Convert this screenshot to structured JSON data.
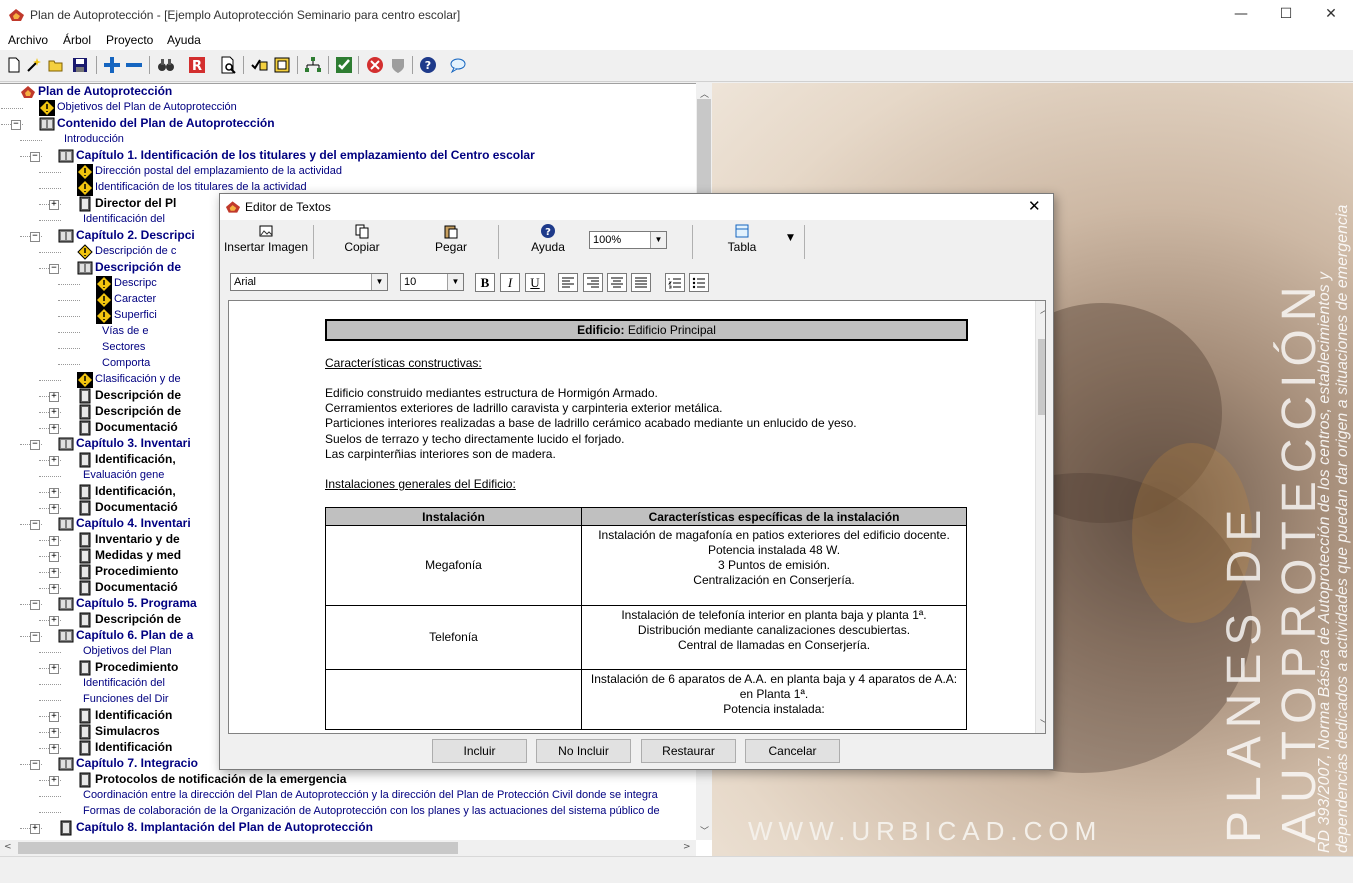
{
  "window": {
    "title": "Plan de Autoprotección - [Ejemplo Autoprotección Seminario para centro escolar]",
    "min": "—",
    "max": "☐",
    "close": "✕"
  },
  "menu": [
    "Archivo",
    "Árbol",
    "Proyecto",
    "Ayuda"
  ],
  "toolbar_icons": [
    "new-icon",
    "wand-icon",
    "open-icon",
    "save-icon",
    "add-icon",
    "remove-icon",
    "binoculars-icon",
    "report-icon",
    "preview-icon",
    "check-list-icon",
    "note-icon",
    "tree-icon",
    "check-icon",
    "stop-icon",
    "shield-icon",
    "help-icon",
    "chat-icon"
  ],
  "tree": [
    {
      "level": 0,
      "label": "Plan de Autoprotección",
      "style": "b",
      "icon": "root",
      "exp": ""
    },
    {
      "level": 1,
      "label": "Objetivos del Plan de Autoprotección",
      "style": "n",
      "icon": "warn",
      "exp": ""
    },
    {
      "level": 1,
      "label": "Contenido del Plan de Autoprotección",
      "style": "b",
      "icon": "book",
      "exp": "-"
    },
    {
      "level": 2,
      "label": "Introducción",
      "style": "n",
      "icon": "",
      "exp": ""
    },
    {
      "level": 2,
      "label": "Capítulo 1. Identificación de los titulares y del emplazamiento del Centro escolar",
      "style": "b",
      "icon": "book",
      "exp": "-"
    },
    {
      "level": 3,
      "label": "Dirección postal del emplazamiento de la actividad",
      "style": "n",
      "icon": "warn",
      "exp": ""
    },
    {
      "level": 3,
      "label": "Identificación de los titulares de la actividad",
      "style": "n",
      "icon": "warn",
      "exp": ""
    },
    {
      "level": 3,
      "label": "Director del Pl",
      "style": "bk",
      "icon": "doc",
      "exp": "+"
    },
    {
      "level": 3,
      "label": "Identificación del",
      "style": "n",
      "icon": "",
      "exp": ""
    },
    {
      "level": 2,
      "label": "Capítulo 2. Descripci",
      "style": "b",
      "icon": "book",
      "exp": "-"
    },
    {
      "level": 3,
      "label": "Descripción de c",
      "style": "n",
      "icon": "warn2",
      "exp": ""
    },
    {
      "level": 3,
      "label": "Descripción de",
      "style": "b",
      "icon": "book",
      "exp": "-"
    },
    {
      "level": 4,
      "label": "Descripc",
      "style": "n",
      "icon": "warn",
      "exp": ""
    },
    {
      "level": 4,
      "label": "Caracter",
      "style": "n",
      "icon": "warn",
      "exp": ""
    },
    {
      "level": 4,
      "label": "Superfici",
      "style": "n",
      "icon": "warn",
      "exp": ""
    },
    {
      "level": 4,
      "label": "Vías de e",
      "style": "n",
      "icon": "",
      "exp": ""
    },
    {
      "level": 4,
      "label": "Sectores",
      "style": "n",
      "icon": "",
      "exp": ""
    },
    {
      "level": 4,
      "label": "Comporta",
      "style": "n",
      "icon": "",
      "exp": ""
    },
    {
      "level": 3,
      "label": "Clasificación y de",
      "style": "n",
      "icon": "warn",
      "exp": ""
    },
    {
      "level": 3,
      "label": "Descripción de",
      "style": "bk",
      "icon": "doc",
      "exp": "+"
    },
    {
      "level": 3,
      "label": "Descripción de",
      "style": "bk",
      "icon": "doc",
      "exp": "+"
    },
    {
      "level": 3,
      "label": "Documentació",
      "style": "bk",
      "icon": "doc",
      "exp": "+"
    },
    {
      "level": 2,
      "label": "Capítulo 3. Inventari",
      "style": "b",
      "icon": "book",
      "exp": "-"
    },
    {
      "level": 3,
      "label": "Identificación,",
      "style": "bk",
      "icon": "doc",
      "exp": "+"
    },
    {
      "level": 3,
      "label": "Evaluación gene",
      "style": "n",
      "icon": "",
      "exp": ""
    },
    {
      "level": 3,
      "label": "Identificación,",
      "style": "bk",
      "icon": "doc",
      "exp": "+"
    },
    {
      "level": 3,
      "label": "Documentació",
      "style": "bk",
      "icon": "doc",
      "exp": "+"
    },
    {
      "level": 2,
      "label": "Capítulo 4. Inventari",
      "style": "b",
      "icon": "book",
      "exp": "-"
    },
    {
      "level": 3,
      "label": "Inventario y de",
      "style": "bk",
      "icon": "doc",
      "exp": "+"
    },
    {
      "level": 3,
      "label": "Medidas y med",
      "style": "bk",
      "icon": "doc",
      "exp": "+"
    },
    {
      "level": 3,
      "label": "Procedimiento",
      "style": "bk",
      "icon": "doc",
      "exp": "+"
    },
    {
      "level": 3,
      "label": "Documentació",
      "style": "bk",
      "icon": "doc",
      "exp": "+"
    },
    {
      "level": 2,
      "label": "Capítulo 5. Programa",
      "style": "b",
      "icon": "book",
      "exp": "-"
    },
    {
      "level": 3,
      "label": "Descripción de",
      "style": "bk",
      "icon": "doc",
      "exp": "+"
    },
    {
      "level": 2,
      "label": "Capítulo 6. Plan de a",
      "style": "b",
      "icon": "book",
      "exp": "-"
    },
    {
      "level": 3,
      "label": "Objetivos del Plan",
      "style": "n",
      "icon": "",
      "exp": ""
    },
    {
      "level": 3,
      "label": "Procedimiento",
      "style": "bk",
      "icon": "doc",
      "exp": "+"
    },
    {
      "level": 3,
      "label": "Identificación del",
      "style": "n",
      "icon": "",
      "exp": ""
    },
    {
      "level": 3,
      "label": "Funciones del Dir",
      "style": "n",
      "icon": "",
      "exp": ""
    },
    {
      "level": 3,
      "label": "Identificación",
      "style": "bk",
      "icon": "doc",
      "exp": "+"
    },
    {
      "level": 3,
      "label": "Simulacros",
      "style": "bk",
      "icon": "doc",
      "exp": "+"
    },
    {
      "level": 3,
      "label": "Identificación",
      "style": "bk",
      "icon": "doc",
      "exp": "+"
    },
    {
      "level": 2,
      "label": "Capítulo 7. Integracio",
      "style": "b",
      "icon": "book",
      "exp": "-"
    },
    {
      "level": 3,
      "label": "Protocolos de notificación de la emergencia",
      "style": "bk",
      "icon": "doc",
      "exp": "+"
    },
    {
      "level": 3,
      "label": "Coordinación entre la dirección del Plan de Autoprotección y la dirección del Plan de Protección Civil donde se integra",
      "style": "n",
      "icon": "",
      "exp": ""
    },
    {
      "level": 3,
      "label": "Formas de colaboración de la Organización de Autoprotección con los planes y las actuaciones del sistema público de",
      "style": "n",
      "icon": "",
      "exp": ""
    },
    {
      "level": 2,
      "label": "Capítulo 8. Implantación del Plan de Autoprotección",
      "style": "b",
      "icon": "doc",
      "exp": "+"
    }
  ],
  "splash": {
    "big1": "PLANES DE",
    "big2": "AUTOPROTECCIÓN",
    "small1": "RD 393/2007, Norma Básica de Autoprotección de los centros, establecimientos y",
    "small2": "dependencias dedicados a actividades que puedan dar origen a situaciones de emergencia",
    "url": "WWW.URBICAD.COM"
  },
  "dialog": {
    "title": "Editor de Textos",
    "close": "✕",
    "tools": {
      "insert_image": "Insertar Imagen",
      "copy": "Copiar",
      "paste": "Pegar",
      "help": "Ayuda",
      "zoom": "100%",
      "table": "Tabla"
    },
    "font": "Arial",
    "size": "10",
    "fmt": {
      "bold": "B",
      "italic": "I",
      "underline": "U"
    },
    "document": {
      "heading_bold": "Edificio:",
      "heading_rest": " Edificio Principal",
      "section1": "Características constructivas:",
      "lines": [
        " Edificio construido mediantes estructura de Hormigón Armado.",
        "Cerramientos exteriores de ladrillo caravista y carpinteria exterior metálica.",
        "Particiones interiores realizadas a base de ladrillo cerámico acabado mediante un enlucido de yeso.",
        "Suelos de terrazo  y techo directamente lucido el forjado.",
        "Las carpinterñias interiores son de madera."
      ],
      "section2": "Instalaciones generales del Edificio:",
      "table": {
        "headers": [
          "Instalación",
          "Características específicas de la instalación"
        ],
        "rows": [
          {
            "name": "Megafonía",
            "desc": [
              "Instalación de magafonía en patios exteriores del edificio docente.",
              "Potencia instalada 48 W.",
              "3 Puntos de emisión.",
              "Centralización en Conserjería."
            ]
          },
          {
            "name": "Telefonía",
            "desc": [
              "Instalación de telefonía interior en planta baja y planta 1ª.",
              "Distribución mediante canalizaciones descubiertas.",
              "Central de llamadas en Conserjería."
            ]
          },
          {
            "name": "",
            "desc": [
              "Instalación de 6 aparatos de A.A. en planta baja y 4 aparatos de A.A: en Planta 1ª.",
              "Potencia instalada:"
            ]
          }
        ]
      }
    },
    "buttons": {
      "include": "Incluir",
      "no_include": "No Incluir",
      "restore": "Restaurar",
      "cancel": "Cancelar"
    }
  }
}
